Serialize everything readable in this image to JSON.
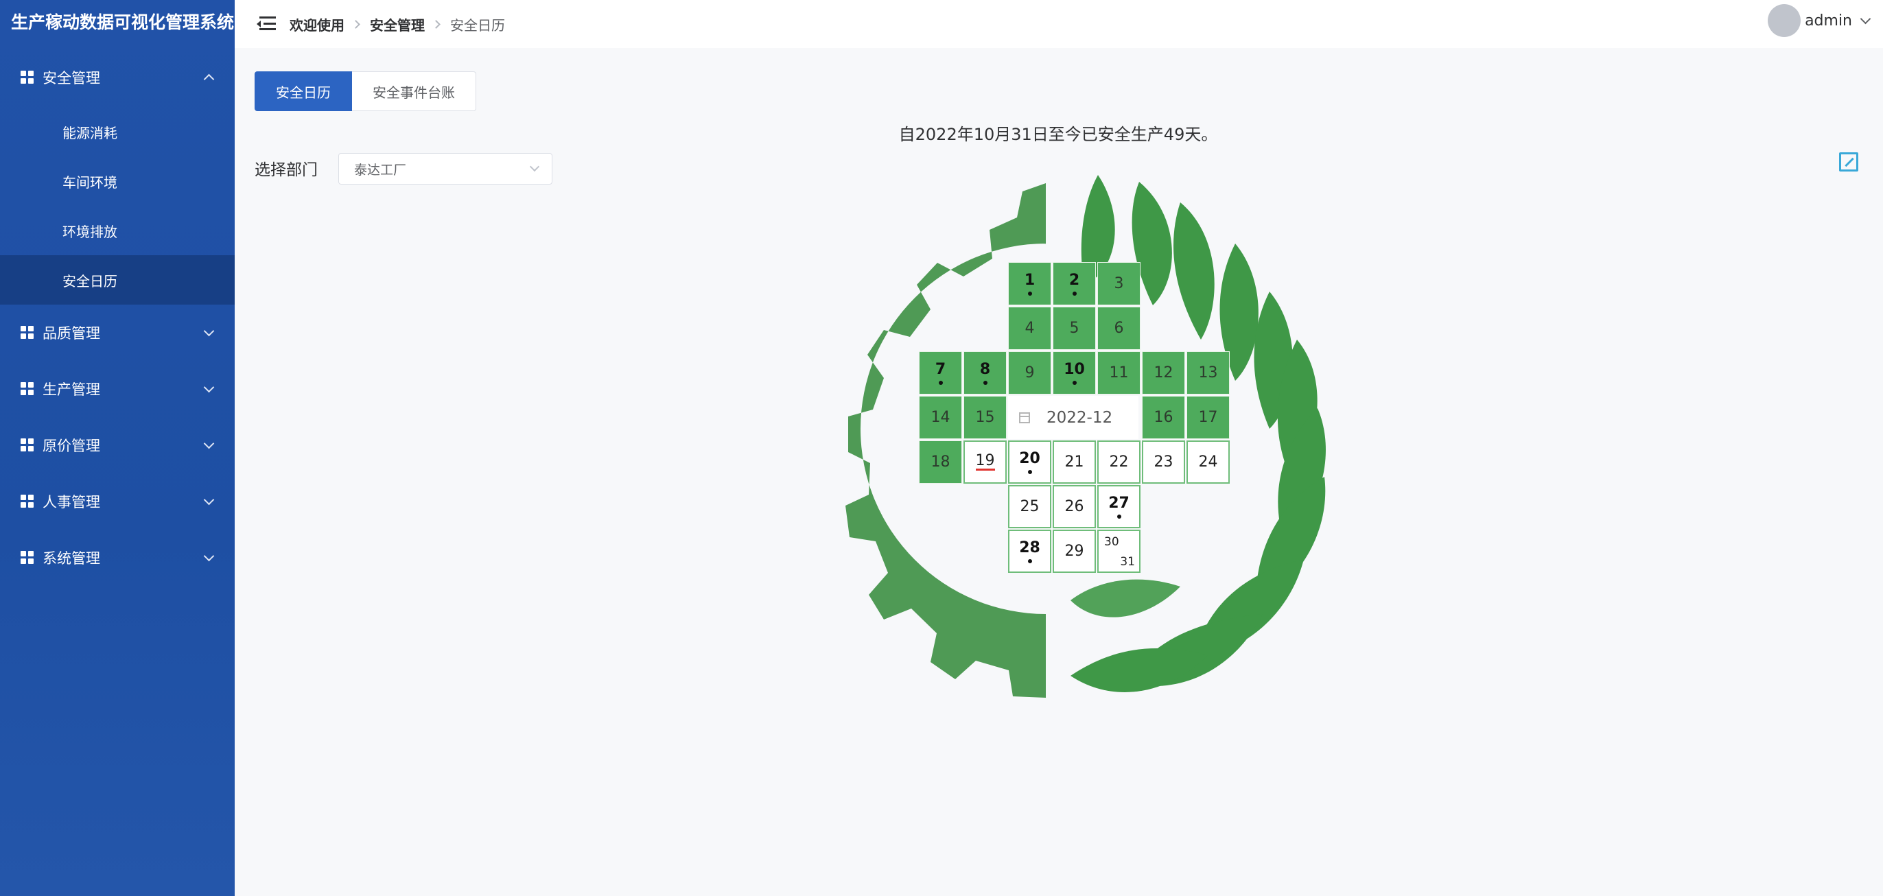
{
  "app": {
    "title": "生产稼动数据可视化管理系统"
  },
  "sidebar": {
    "groups": [
      {
        "label": "安全管理",
        "expanded": true,
        "items": [
          {
            "label": "能源消耗"
          },
          {
            "label": "车间环境"
          },
          {
            "label": "环境排放"
          },
          {
            "label": "安全日历",
            "active": true
          }
        ]
      },
      {
        "label": "品质管理",
        "expanded": false
      },
      {
        "label": "生产管理",
        "expanded": false
      },
      {
        "label": "原价管理",
        "expanded": false
      },
      {
        "label": "人事管理",
        "expanded": false
      },
      {
        "label": "系统管理",
        "expanded": false
      }
    ]
  },
  "header": {
    "breadcrumb": [
      "欢迎使用",
      "安全管理",
      "安全日历"
    ],
    "user": "admin"
  },
  "tabs": [
    {
      "label": "安全日历",
      "active": true
    },
    {
      "label": "安全事件台账",
      "active": false
    }
  ],
  "summary": "自2022年10月31日至今已安全生产49天。",
  "filter": {
    "label": "选择部门",
    "value": "泰达工厂"
  },
  "calendar": {
    "month": "2022-12",
    "days": [
      {
        "day": "1",
        "state": "green",
        "marked": true
      },
      {
        "day": "2",
        "state": "green",
        "marked": true
      },
      {
        "day": "3",
        "state": "green"
      },
      {
        "day": "4",
        "state": "green"
      },
      {
        "day": "5",
        "state": "green"
      },
      {
        "day": "6",
        "state": "green"
      },
      {
        "day": "7",
        "state": "green",
        "marked": true
      },
      {
        "day": "8",
        "state": "green",
        "marked": true
      },
      {
        "day": "9",
        "state": "green"
      },
      {
        "day": "10",
        "state": "green",
        "marked": true
      },
      {
        "day": "11",
        "state": "green"
      },
      {
        "day": "12",
        "state": "green"
      },
      {
        "day": "13",
        "state": "green"
      },
      {
        "day": "14",
        "state": "green"
      },
      {
        "day": "15",
        "state": "green"
      },
      {
        "day": "16",
        "state": "green"
      },
      {
        "day": "17",
        "state": "green"
      },
      {
        "day": "18",
        "state": "green"
      },
      {
        "day": "19",
        "state": "white",
        "today": true
      },
      {
        "day": "20",
        "state": "white",
        "marked": true
      },
      {
        "day": "21",
        "state": "white"
      },
      {
        "day": "22",
        "state": "white"
      },
      {
        "day": "23",
        "state": "white"
      },
      {
        "day": "24",
        "state": "white"
      },
      {
        "day": "25",
        "state": "white"
      },
      {
        "day": "26",
        "state": "white"
      },
      {
        "day": "27",
        "state": "white",
        "marked": true
      },
      {
        "day": "28",
        "state": "white",
        "marked": true
      },
      {
        "day": "29",
        "state": "white"
      },
      {
        "day": "30",
        "state": "white",
        "split_with": "31"
      }
    ]
  },
  "colors": {
    "sidebar": "#1f50a6",
    "primary": "#2c64c2",
    "logo_green": "#4f9a55",
    "leaf_green": "#3f9847",
    "cell_green": "#4eab5c"
  },
  "icons": {
    "menu_group": "grid-icon",
    "collapse": "hamburger-icon",
    "fullscreen": "expand-icon",
    "calendar": "calendar-icon"
  }
}
